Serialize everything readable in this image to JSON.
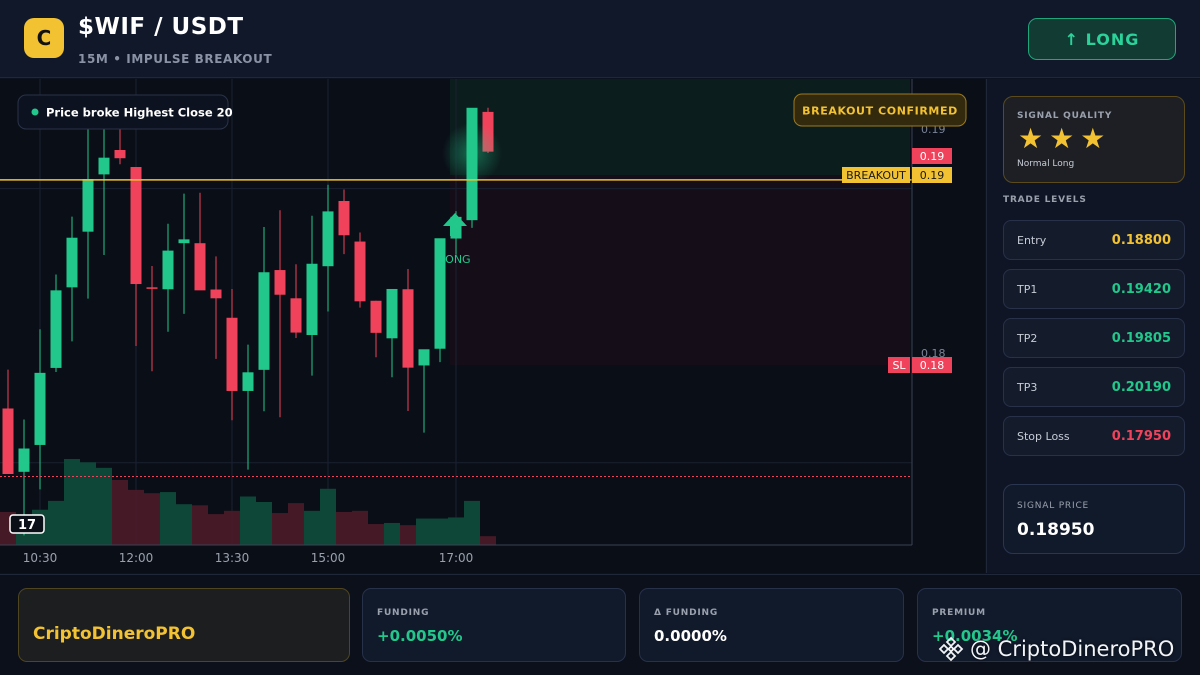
{
  "header": {
    "logo_letter": "C",
    "pair": "$WIF / USDT",
    "subtitle": "15M • IMPULSE BREAKOUT",
    "direction_button": "↑ LONG"
  },
  "chart": {
    "note_badge": "Price broke Highest Close 20",
    "confirm_badge": "BREAKOUT CONFIRMED",
    "signal_marker_label": "LONG",
    "tv_logo": "17",
    "axis_labels": {
      "upper": "0.19",
      "lower": "0.18"
    },
    "price_tags": {
      "last": "0.19",
      "breakout_name": "BREAKOUT",
      "breakout_value": "0.19",
      "sl_name": "SL",
      "sl_value": "0.18"
    },
    "time_labels": [
      "10:30",
      "12:00",
      "13:30",
      "15:00",
      "17:00"
    ],
    "colors": {
      "up": "#22c88b",
      "down": "#f0435b",
      "breakout": "#f3c232",
      "sl": "#f0435b"
    }
  },
  "chart_data": {
    "type": "candlestick",
    "x": [
      "09:45",
      "10:00",
      "10:15",
      "10:30",
      "10:45",
      "11:00",
      "11:15",
      "11:30",
      "11:45",
      "12:00",
      "12:15",
      "12:30",
      "12:45",
      "13:00",
      "13:15",
      "13:30",
      "13:45",
      "14:00",
      "14:15",
      "14:30",
      "14:45",
      "15:00",
      "15:15",
      "15:30",
      "15:45",
      "16:00",
      "16:15",
      "16:30",
      "16:45",
      "17:00",
      "17:15"
    ],
    "series": [
      {
        "open": [
          0.18198,
          0.17967,
          0.18065,
          0.18346,
          0.1864,
          0.18843,
          0.19052,
          0.19141,
          0.19079,
          0.1864,
          0.18633,
          0.18801,
          0.18801,
          0.18632,
          0.18529,
          0.18262,
          0.18339,
          0.18703,
          0.186,
          0.18466,
          0.18717,
          0.18955,
          0.18807,
          0.18591,
          0.18454,
          0.18633,
          0.18355,
          0.18416,
          0.18818,
          0.18885,
          0.1928
        ],
        "high": [
          0.1834,
          0.18158,
          0.18487,
          0.18687,
          0.18898,
          0.19277,
          0.19277,
          0.19224,
          0.19079,
          0.18718,
          0.18872,
          0.18982,
          0.18985,
          0.18753,
          0.18634,
          0.18431,
          0.1886,
          0.18921,
          0.18724,
          0.18901,
          0.19014,
          0.18997,
          0.1884,
          0.18591,
          0.18616,
          0.18707,
          0.18407,
          0.18764,
          0.18918,
          0.1928,
          0.19295
        ],
        "low": [
          0.17999,
          0.17735,
          0.17903,
          0.18331,
          0.18443,
          0.18599,
          0.18758,
          0.19089,
          0.18426,
          0.18334,
          0.18478,
          0.18543,
          0.18666,
          0.18379,
          0.18155,
          0.17975,
          0.18188,
          0.18166,
          0.18455,
          0.18318,
          0.18552,
          0.18761,
          0.18566,
          0.18385,
          0.18312,
          0.18189,
          0.1811,
          0.18367,
          0.18759,
          0.18857,
          0.1913
        ],
        "close": [
          0.17959,
          0.18052,
          0.18328,
          0.18629,
          0.18821,
          0.19035,
          0.19113,
          0.19111,
          0.18652,
          0.18639,
          0.18774,
          0.18815,
          0.18629,
          0.186,
          0.18262,
          0.1833,
          0.18695,
          0.18613,
          0.18475,
          0.18726,
          0.18917,
          0.1883,
          0.18589,
          0.18474,
          0.18634,
          0.18347,
          0.18414,
          0.18819,
          0.18897,
          0.19295,
          0.19135
        ]
      }
    ],
    "volume": [
      30,
      20,
      32,
      40,
      78,
      75,
      70,
      59,
      50,
      47,
      48,
      37,
      36,
      28,
      31,
      44,
      39,
      29,
      38,
      31,
      51,
      30,
      31,
      19,
      20,
      18,
      24,
      24,
      25,
      40,
      8
    ],
    "breakout_level": 0.19032,
    "stop_loss_level": 0.1795,
    "ylim": [
      0.177,
      0.194
    ]
  },
  "sidebar": {
    "quality_label": "SIGNAL QUALITY",
    "stars": [
      "★",
      "★",
      "★"
    ],
    "quality_value": "Normal Long",
    "levels_title": "TRADE LEVELS",
    "levels": [
      {
        "name": "Entry",
        "value": "0.18800",
        "color": "#f3c232"
      },
      {
        "name": "TP1",
        "value": "0.19420",
        "color": "#22c88b"
      },
      {
        "name": "TP2",
        "value": "0.19805",
        "color": "#22c88b"
      },
      {
        "name": "TP3",
        "value": "0.20190",
        "color": "#22c88b"
      },
      {
        "name": "Stop Loss",
        "value": "0.17950",
        "color": "#f0435b"
      }
    ],
    "signal_price_label": "SIGNAL PRICE",
    "signal_price_value": "0.18950"
  },
  "footer": {
    "brand": "CriptoDineroPRO",
    "metrics": [
      {
        "label": "FUNDING",
        "value": "+0.0050%",
        "color": "#22c88b"
      },
      {
        "label": "Δ FUNDING",
        "value": "0.0000%",
        "color": "#ffffff"
      },
      {
        "label": "PREMIUM",
        "value": "+0.0034%",
        "color": "#22c88b"
      }
    ],
    "watermark": "@ CriptoDineroPRO"
  }
}
